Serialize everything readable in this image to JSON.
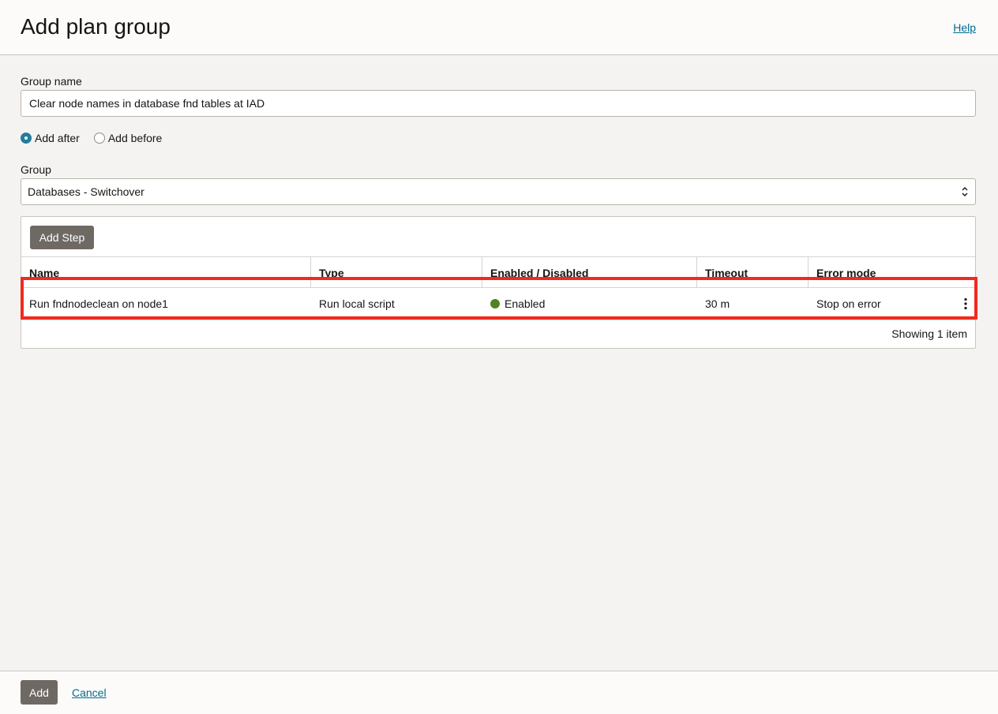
{
  "header": {
    "title": "Add plan group",
    "help_label": "Help"
  },
  "form": {
    "group_name_label": "Group name",
    "group_name_value": "Clear node names in database fnd tables at IAD",
    "radio_add_after": "Add after",
    "radio_add_before": "Add before",
    "group_label": "Group",
    "group_value": "Databases - Switchover"
  },
  "table": {
    "add_step_label": "Add Step",
    "columns": [
      "Name",
      "Type",
      "Enabled / Disabled",
      "Timeout",
      "Error mode"
    ],
    "rows": [
      {
        "name": "Run fndnodeclean on node1",
        "type": "Run local script",
        "status": "Enabled",
        "timeout": "30 m",
        "error_mode": "Stop on error"
      }
    ],
    "showing": "Showing 1 item",
    "status_color": "#508223",
    "highlight_color": "#f02a1f"
  },
  "footer": {
    "add_label": "Add",
    "cancel_label": "Cancel"
  }
}
